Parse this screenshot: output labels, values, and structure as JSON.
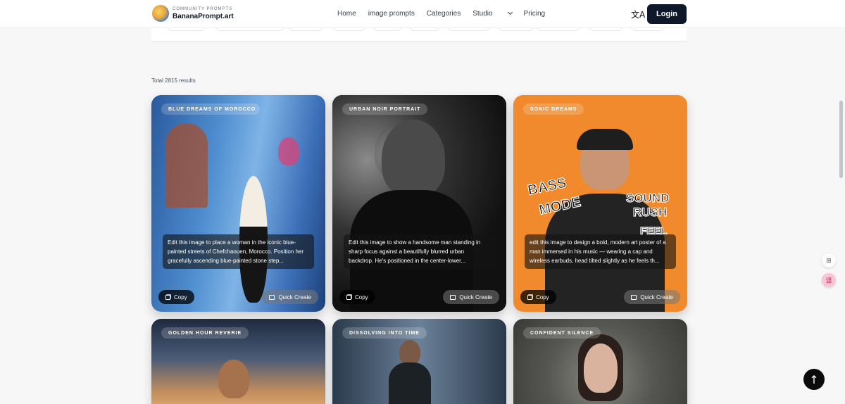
{
  "brand": {
    "sub": "COMMUNITY PROMPTS",
    "name": "BananaPrompt.art"
  },
  "nav": {
    "home": "Home",
    "image_prompts": "image prompts",
    "categories": "Categories",
    "studio": "Studio",
    "pricing": "Pricing"
  },
  "header": {
    "translate_icon": "translate-icon",
    "login": "Login"
  },
  "results": {
    "text": "Total 2815 results"
  },
  "cards": [
    {
      "tag": "BLUE DREAMS OF MOROCCO",
      "caption": "Edit this image to place a woman in the iconic blue-painted streets of Chefchaouen, Morocco. Position her gracefully ascending blue-painted stone step...",
      "copy": "Copy",
      "quick": "Quick Create"
    },
    {
      "tag": "URBAN NOIR PORTRAIT",
      "caption": "Edit this image to show a handsome man standing in sharp focus against a beautifully blurred urban backdrop. He's positioned in the center-lower...",
      "copy": "Copy",
      "quick": "Quick Create"
    },
    {
      "tag": "SONIC DREAMS",
      "caption": "edit this image to design a bold, modern art poster of a man immersed in his music — wearing a cap and wireless earbuds, head tilted slightly as he feels th...",
      "copy": "Copy",
      "quick": "Quick Create"
    },
    {
      "tag": "GOLDEN HOUR REVERIE"
    },
    {
      "tag": "DISSOLVING INTO TIME"
    },
    {
      "tag": "CONFIDENT SILENCE"
    }
  ],
  "poster_text": {
    "line1": "BASS",
    "line2": "MODE",
    "line3": "SOUND",
    "line4": "RUSH",
    "line5": "FEEL"
  },
  "side": {
    "apps_icon": "apps-icon",
    "translate_badge": "translate-badge-icon",
    "back_to_top": "arrow-up-icon"
  },
  "colors": {
    "accent": "#0f172a",
    "orange": "#f08a2c"
  }
}
